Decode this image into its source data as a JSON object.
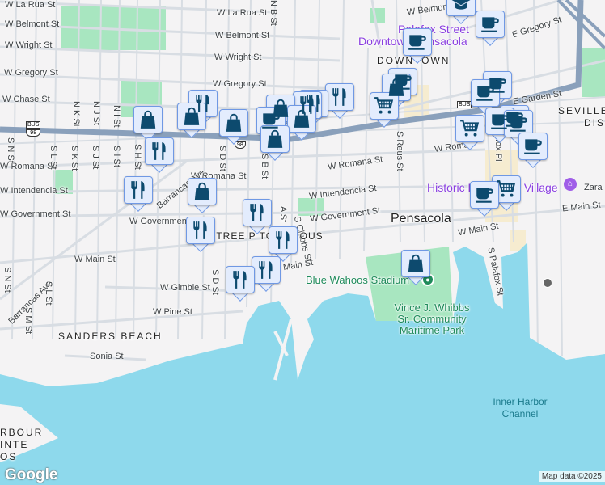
{
  "streets": {
    "la_rua_w": "W La Rua St",
    "la_rua_e": "W La Rua St",
    "belmont_w": "W Belmont St",
    "belmont_e": "W Belmont St",
    "belmont_ne": "W Belmon",
    "wright_w": "W Wright St",
    "wright_e": "W Wright St",
    "gregory_w": "W Gregory St",
    "gregory_e": "W Gregory St",
    "chase": "W Chase St",
    "romana_w": "W Romana St",
    "romana_c": "W Romana St",
    "romana_e": "W Romana St",
    "romana_ne": "W Roma",
    "intendencia_w": "W Intendencia St",
    "intendencia_e": "W Intendencia St",
    "government_w": "W Government St",
    "government_c": "W Governmen",
    "government_e": "W Government St",
    "main_w": "W Main St",
    "main_c": "Main St",
    "main_e": "W Main St",
    "e_main": "E Main St",
    "gimble": "W Gimble St",
    "pine": "W Pine St",
    "sonia": "Sonia St",
    "e_gregory": "E Gregory St",
    "e_garden": "E Garden St",
    "barrancas": "Barrancas Ave",
    "barrancas_sw": "Barrancas Ave",
    "s_n": "S N St",
    "n_k": "N K St",
    "n_j": "N J St",
    "n_i": "N I St",
    "s_l": "S L St",
    "s_k": "S K St",
    "s_j": "S J St",
    "s_i": "S I St",
    "s_h": "S H St",
    "s_d": "S D St",
    "s_d2": "S D St",
    "s_b": "S B St",
    "n_b": "N B St",
    "s_a": "A St",
    "clubbs": "S Clubbs St",
    "reus": "S Reus St",
    "palafox": "S Palafox St",
    "palafox_pl": "fox Pl",
    "s_m": "S M St",
    "s_l2": "S L St",
    "s_n2": "S N St",
    "zara": "Zara"
  },
  "areas": {
    "downtown": "DOWNTOWN",
    "sanders": "SANDERS BEACH",
    "townhouse": "CHTREE P  TOWNHOUS",
    "seville": "SEVILLE",
    "seville2": "DIST",
    "harbour1": "RBOUR",
    "harbour2": "INTE",
    "harbour3": "OS",
    "city": "Pensacola"
  },
  "pois": {
    "palafox": "Palafox Street",
    "downtown_pensacola": "Downtown Pensacola",
    "historic": "Historic Pensacola Village",
    "stadium": "Blue Wahoos Stadium",
    "park": "Vince J. Whibbs Sr. Community Maritime Park"
  },
  "water": {
    "channel": "Inner Harbor Channel"
  },
  "shields": {
    "bus": "BUS",
    "route": "98"
  },
  "branding": {
    "logo": "Google",
    "attribution": "Map data ©2025"
  },
  "colors": {
    "land": "#f4f3f4",
    "water": "#8ed9ec",
    "park": "#a8e6c0",
    "highway": "#8aa0bb",
    "marker_bg": "#e3ecfd",
    "marker_icon": "#0d4a6e"
  }
}
